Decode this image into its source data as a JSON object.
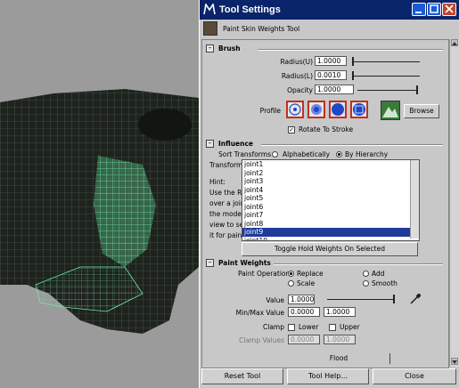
{
  "window": {
    "title": "Tool Settings",
    "tool_name": "Paint Skin Weights Tool",
    "colors": {
      "titlebar": "#0a246a",
      "panel": "#c8c8c8",
      "selection": "#1e3a9a",
      "profile_accent": "#c03020"
    }
  },
  "brush": {
    "header": "Brush",
    "radius_upper_label": "Radius(U)",
    "radius_upper_value": "1.0000",
    "radius_lower_label": "Radius(L)",
    "radius_lower_value": "0.0010",
    "opacity_label": "Opacity",
    "opacity_value": "1.0000",
    "profile_label": "Profile",
    "browse_label": "Browse",
    "rotate_label": "Rotate To Stroke",
    "rotate_checked": true,
    "icons": [
      "gaussian-brush-icon",
      "soft-brush-icon",
      "solid-brush-icon",
      "square-brush-icon",
      "image-brush-icon"
    ]
  },
  "influence": {
    "header": "Influence",
    "sort_label": "Sort Transforms",
    "sort_alpha": "Alphabetically",
    "sort_hier": "By Hierarchy",
    "transform_label": "Transform",
    "hint": [
      "Hint:",
      "Use the RMB",
      "over a joint in",
      "the modeling",
      "view to select",
      "it for painting."
    ],
    "joints": [
      "joint1",
      "joint2",
      "joint3",
      "joint4",
      "joint5",
      "joint6",
      "joint7",
      "joint8",
      "joint9",
      "joint10"
    ],
    "selected_index": 8,
    "toggle_label": "Toggle Hold Weights On Selected"
  },
  "paint": {
    "header": "Paint Weights",
    "operation_label": "Paint Operation",
    "op_replace": "Replace",
    "op_add": "Add",
    "op_scale": "Scale",
    "op_smooth": "Smooth",
    "value_label": "Value",
    "value": "1.0000",
    "minmax_label": "Min/Max Value",
    "min_value": "0.0000",
    "max_value": "1.0000",
    "clamp_label": "Clamp",
    "clamp_lower": "Lower",
    "clamp_upper": "Upper",
    "clamp_values_label": "Clamp Values",
    "clamp_min": "0.0000",
    "clamp_max": "1.0000",
    "flood_label": "Flood"
  },
  "buttons": {
    "reset": "Reset Tool",
    "help": "Tool Help...",
    "close": "Close"
  }
}
